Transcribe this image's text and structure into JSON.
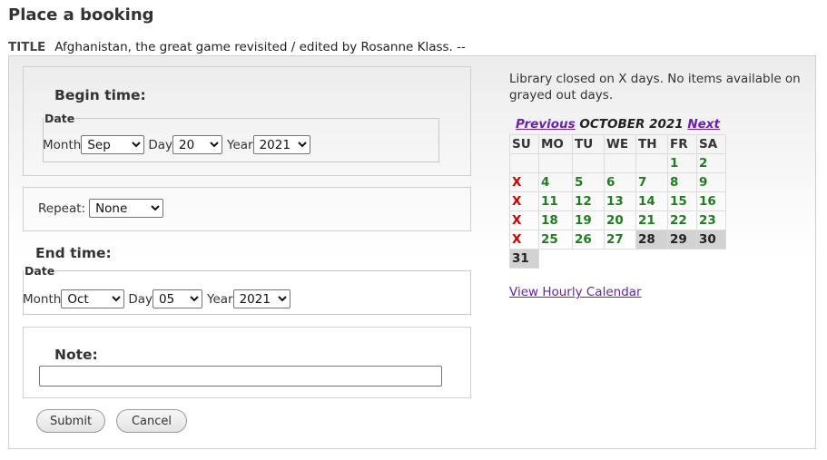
{
  "page": {
    "title": "Place a booking"
  },
  "item": {
    "label": "TITLE",
    "value": "Afghanistan, the great game revisited / edited by Rosanne Klass. --"
  },
  "begin": {
    "heading": "Begin time:",
    "legend": "Date",
    "month_label": "Month",
    "month": "Sep",
    "day_label": "Day",
    "day": "20",
    "year_label": "Year",
    "year": "2021"
  },
  "repeat": {
    "label": "Repeat:",
    "value": "None"
  },
  "end": {
    "heading": "End time:",
    "legend": "Date",
    "month_label": "Month",
    "month": "Oct",
    "day_label": "Day",
    "day": "05",
    "year_label": "Year",
    "year": "2021"
  },
  "note": {
    "heading": "Note:",
    "value": ""
  },
  "buttons": {
    "submit": "Submit",
    "cancel": "Cancel"
  },
  "calendar": {
    "closed_note": "Library closed on X days. No items available on grayed out days.",
    "prev": "Previous",
    "month_title": "OCTOBER 2021",
    "next": "Next",
    "weekdays": [
      "SU",
      "MO",
      "TU",
      "WE",
      "TH",
      "FR",
      "SA"
    ],
    "weeks": [
      [
        {
          "t": "",
          "s": "empty"
        },
        {
          "t": "",
          "s": "empty"
        },
        {
          "t": "",
          "s": "empty"
        },
        {
          "t": "",
          "s": "empty"
        },
        {
          "t": "",
          "s": "empty"
        },
        {
          "t": "1",
          "s": "av"
        },
        {
          "t": "2",
          "s": "av"
        }
      ],
      [
        {
          "t": "X",
          "s": "x"
        },
        {
          "t": "4",
          "s": "av"
        },
        {
          "t": "5",
          "s": "av"
        },
        {
          "t": "6",
          "s": "av"
        },
        {
          "t": "7",
          "s": "av"
        },
        {
          "t": "8",
          "s": "av"
        },
        {
          "t": "9",
          "s": "av"
        }
      ],
      [
        {
          "t": "X",
          "s": "x"
        },
        {
          "t": "11",
          "s": "av"
        },
        {
          "t": "12",
          "s": "av"
        },
        {
          "t": "13",
          "s": "av"
        },
        {
          "t": "14",
          "s": "av"
        },
        {
          "t": "15",
          "s": "av"
        },
        {
          "t": "16",
          "s": "av"
        }
      ],
      [
        {
          "t": "X",
          "s": "x"
        },
        {
          "t": "18",
          "s": "av"
        },
        {
          "t": "19",
          "s": "av"
        },
        {
          "t": "20",
          "s": "av"
        },
        {
          "t": "21",
          "s": "av"
        },
        {
          "t": "22",
          "s": "av"
        },
        {
          "t": "23",
          "s": "av"
        }
      ],
      [
        {
          "t": "X",
          "s": "x"
        },
        {
          "t": "25",
          "s": "av"
        },
        {
          "t": "26",
          "s": "av"
        },
        {
          "t": "27",
          "s": "av"
        },
        {
          "t": "28",
          "s": "gr"
        },
        {
          "t": "29",
          "s": "gr"
        },
        {
          "t": "30",
          "s": "gr"
        }
      ],
      [
        {
          "t": "31",
          "s": "gr"
        }
      ]
    ],
    "hourly_link": "View Hourly Calendar"
  }
}
